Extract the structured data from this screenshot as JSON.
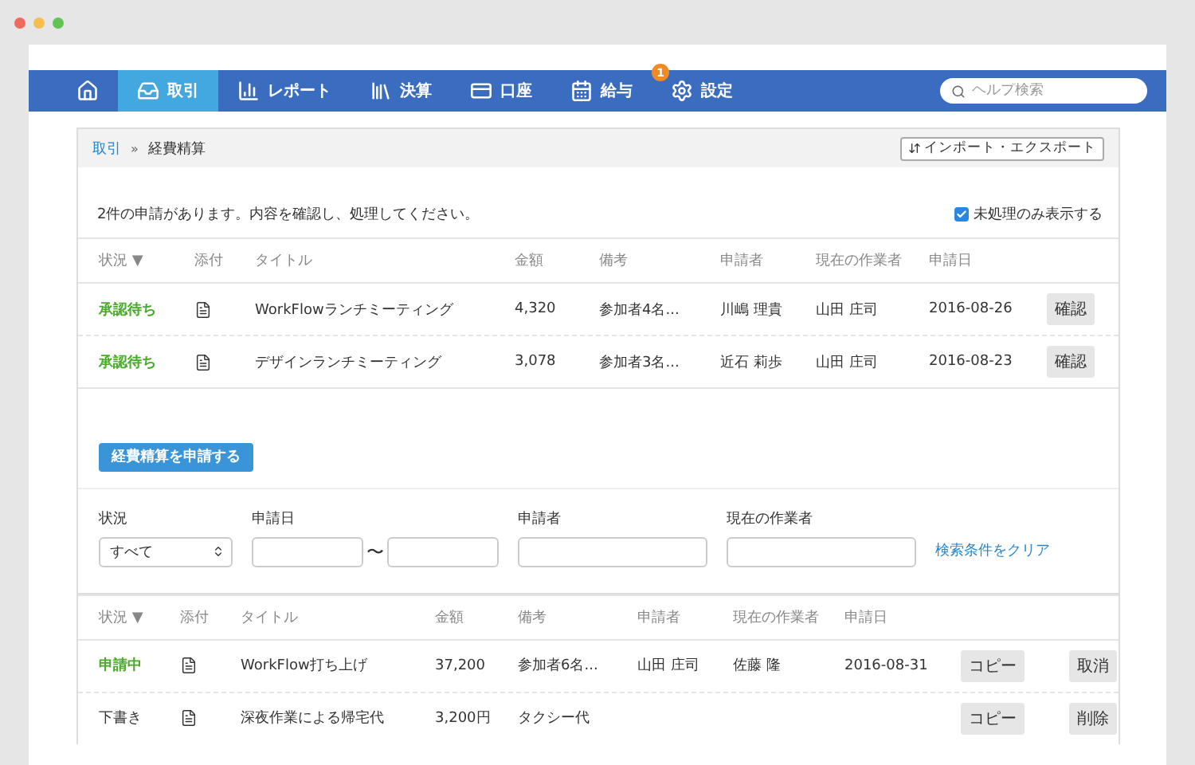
{
  "nav": {
    "items": [
      {
        "selected": false
      },
      {
        "label": "取引",
        "selected": true
      },
      {
        "label": "レポート",
        "selected": false
      },
      {
        "label": "決算",
        "selected": false
      },
      {
        "label": "口座",
        "selected": false
      },
      {
        "label": "給与",
        "selected": false
      },
      {
        "label": "設定",
        "selected": false,
        "badge": "1"
      }
    ],
    "search": {
      "placeholder": "ヘルプ検索"
    }
  },
  "breadcrumb": [
    "取引",
    "»",
    "経費精算"
  ],
  "export_button": "インポート・エクスポート",
  "notice": "2件の申請があります。内容を確認し、処理してください。",
  "unprocessed_only": {
    "label": "未処理のみ表示する",
    "checked": true
  },
  "pending_table": {
    "columns": [
      "状況 ▼",
      "添付",
      "タイトル",
      "金額",
      "備考",
      "申請者",
      "現在の作業者",
      "申請日"
    ],
    "rows": [
      {
        "status": "承認待ち",
        "kind": "active",
        "title": "WorkFlowランチミーティング",
        "amount": "4,320",
        "note": "参加者4名...",
        "applicant": "川嶋 理貴",
        "worker": "山田 庄司",
        "date": "2016-08-26",
        "actions": [
          "確認"
        ]
      },
      {
        "status": "承認待ち",
        "kind": "active",
        "title": "デザインランチミーティング",
        "amount": "3,078",
        "note": "参加者3名...",
        "applicant": "近石 莉歩",
        "worker": "山田 庄司",
        "date": "2016-08-23",
        "actions": [
          "確認"
        ]
      }
    ]
  },
  "apply_button": "経費精算を申請する",
  "filters": {
    "status_label": "状況",
    "status_value": "すべて",
    "date_label": "申請日",
    "date_separator": "〜",
    "applicant_label": "申請者",
    "worker_label": "現在の作業者",
    "clear_link": "検索条件をクリア"
  },
  "my_table": {
    "columns": [
      "状況 ▼",
      "添付",
      "タイトル",
      "金額",
      "備考",
      "申請者",
      "現在の作業者",
      "申請日"
    ],
    "rows": [
      {
        "status": "申請中",
        "kind": "active",
        "title": "WorkFlow打ち上げ",
        "amount": "37,200",
        "note": "参加者6名...",
        "applicant": "山田 庄司",
        "worker": "佐藤 隆",
        "date": "2016-08-31",
        "actions": [
          "コピー",
          "取消"
        ]
      },
      {
        "status": "下書き",
        "kind": "plain",
        "title": "深夜作業による帰宅代",
        "amount": "3,200円",
        "note": "タクシー代",
        "actions": [
          "コピー",
          "削除"
        ]
      }
    ]
  }
}
